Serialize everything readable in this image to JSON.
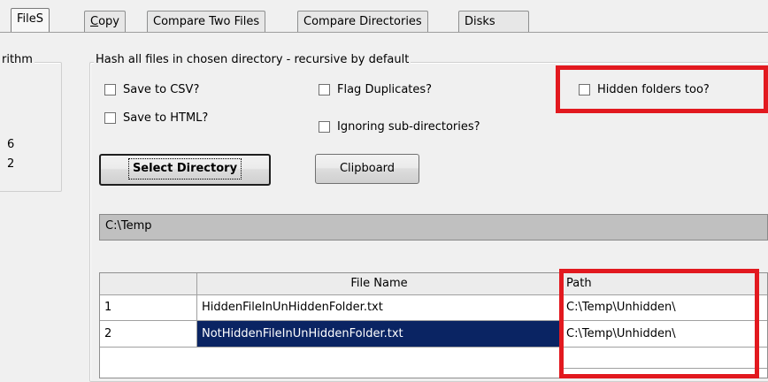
{
  "tabs": [
    {
      "label": "FileS",
      "active": true
    },
    {
      "label": "Copy",
      "underline": "C"
    },
    {
      "label": "Compare Two Files"
    },
    {
      "label": "Compare Directories"
    },
    {
      "label": "Disks"
    }
  ],
  "left_group": {
    "legend": "rithm",
    "values": [
      "6",
      "2"
    ]
  },
  "hash_group": {
    "legend": "Hash all files in chosen directory - recursive by default",
    "checkboxes": {
      "save_csv": "Save to CSV?",
      "save_html": "Save to HTML?",
      "flag_duplicates": "Flag Duplicates?",
      "ignore_subdirs": "Ignoring sub-directories?",
      "hidden_folders": "Hidden folders too?"
    },
    "select_directory": "Select Directory",
    "clipboard": "Clipboard",
    "path": "C:\\Temp"
  },
  "grid": {
    "headers": [
      "",
      "File Name",
      "Path"
    ],
    "rows": [
      {
        "index": "1",
        "file": "HiddenFileInUnHiddenFolder.txt",
        "path": "C:\\Temp\\Unhidden\\"
      },
      {
        "index": "2",
        "file": "NotHiddenFileInUnHiddenFolder.txt",
        "path": "C:\\Temp\\Unhidden\\",
        "selected": true
      }
    ]
  },
  "colors": {
    "highlight_red": "#e2191f",
    "selection": "#0a2463"
  }
}
